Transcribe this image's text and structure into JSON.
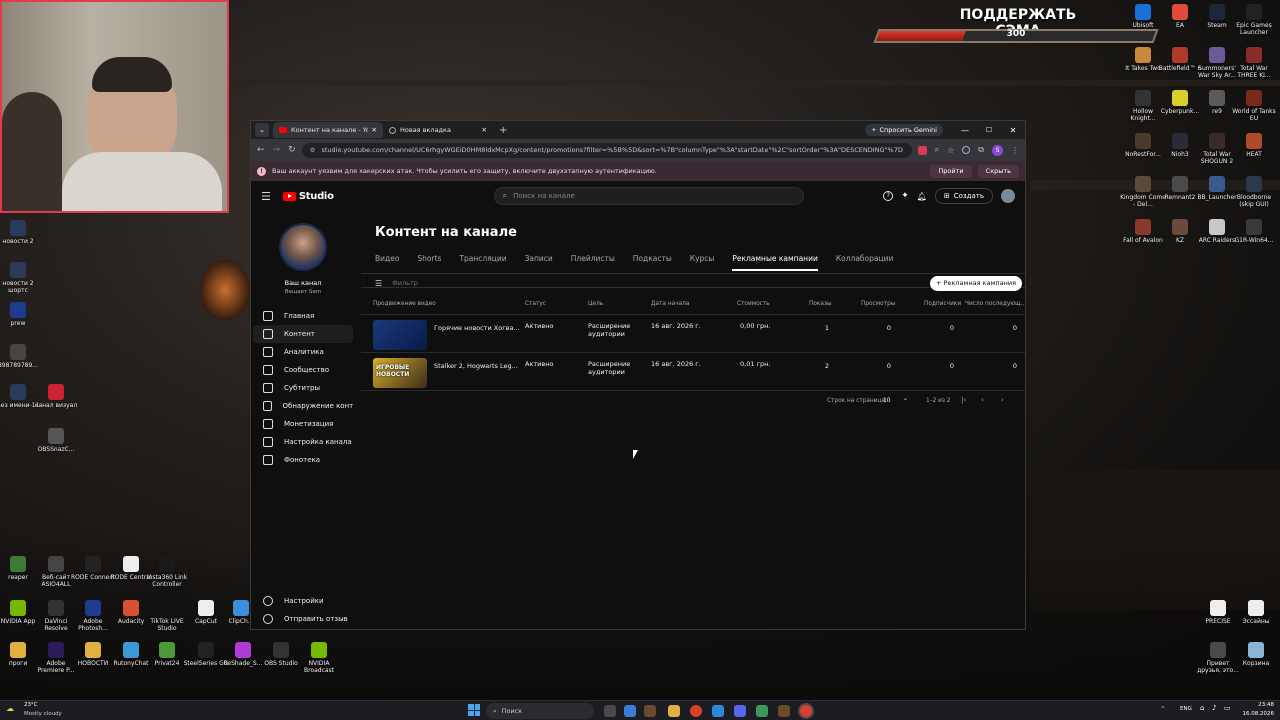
{
  "desktop": {
    "donate": {
      "title": "ПОДДЕРЖАТЬ СЭМА",
      "value": "300"
    },
    "left_icons": [
      {
        "label": "новости 2",
        "color": "#2a3a5a"
      },
      {
        "label": "новости 2 шортс",
        "color": "#2a3a5a"
      },
      {
        "label": "prew",
        "color": "#1e3b8f"
      },
      {
        "label": "898789789...",
        "color": "#444"
      },
      {
        "label": "Без имени-11",
        "color": "#2a3a5a"
      },
      {
        "label": "канал визуал",
        "color": "#c23"
      },
      {
        "label": "OBSSnazC...",
        "color": "#555"
      }
    ],
    "bottom_row1": [
      {
        "label": "reaper",
        "color": "#3a7a3a"
      },
      {
        "label": "Веб-сайт ASIO4ALL",
        "color": "#444"
      },
      {
        "label": "RODE Connect",
        "color": "#222"
      },
      {
        "label": "RODE Central",
        "color": "#eee"
      },
      {
        "label": "Insta360 Link Controller",
        "color": "#1a1a1a"
      }
    ],
    "bottom_row2": [
      {
        "label": "NVIDIA App",
        "color": "#76b900"
      },
      {
        "label": "DaVinci Resolve",
        "color": "#333"
      },
      {
        "label": "Adobe Photosh...",
        "color": "#1e3b8f"
      },
      {
        "label": "Audacity",
        "color": "#d8512c"
      },
      {
        "label": "TikTok LIVE Studio",
        "color": "#111"
      },
      {
        "label": "CapCut",
        "color": "#eee"
      },
      {
        "label": "ClipCh...",
        "color": "#3a8fd8"
      }
    ],
    "bottom_row3": [
      {
        "label": "проги",
        "color": "#e0b040"
      },
      {
        "label": "Adobe Premiere P...",
        "color": "#2a1b5a"
      },
      {
        "label": "НОВОСТИ",
        "color": "#e0b040"
      },
      {
        "label": "RutonyChat",
        "color": "#3a9ad8"
      },
      {
        "label": "Privat24",
        "color": "#4a9a3a"
      },
      {
        "label": "SteelSeries GG",
        "color": "#222"
      },
      {
        "label": "ReShade_S...",
        "color": "#b03ad8"
      },
      {
        "label": "OBS Studio",
        "color": "#333"
      },
      {
        "label": "NVIDIA Broadcast",
        "color": "#76b900"
      }
    ],
    "right_icons": [
      {
        "label": "Ubisoft",
        "color": "#1b6fd8"
      },
      {
        "label": "EA",
        "color": "#e04a3a"
      },
      {
        "label": "Steam",
        "color": "#1b2838"
      },
      {
        "label": "Epic Games Launcher",
        "color": "#222"
      },
      {
        "label": "It Takes Two",
        "color": "#c88a3a"
      },
      {
        "label": "Battlefield™ 6",
        "color": "#b03a2a"
      },
      {
        "label": "Summoners' War Sky Ar...",
        "color": "#6a5a9a"
      },
      {
        "label": "Total War THREE KI...",
        "color": "#8a2a2a"
      },
      {
        "label": "Hollow Knight...",
        "color": "#333"
      },
      {
        "label": "Cyberpunk...",
        "color": "#d8d02a"
      },
      {
        "label": "re9",
        "color": "#5a5a5a"
      },
      {
        "label": "World of Tanks EU",
        "color": "#7a2a1a"
      },
      {
        "label": "NoRestFor...",
        "color": "#4a3a2a"
      },
      {
        "label": "Nioh3",
        "color": "#2a2a3a"
      },
      {
        "label": "Total War SHOGUN 2",
        "color": "#3a2a2a"
      },
      {
        "label": "HEAT",
        "color": "#b04a2a"
      },
      {
        "label": "Kingdom Come - Del...",
        "color": "#5a4a3a"
      },
      {
        "label": "Remnant2",
        "color": "#4a4a4a"
      },
      {
        "label": "BB_Launcher",
        "color": "#3a5a8a"
      },
      {
        "label": "Bloodborne (skip GUI)",
        "color": "#2a3a4a"
      },
      {
        "label": "Fall of Avalon",
        "color": "#8a3a2a"
      },
      {
        "label": "KZ",
        "color": "#6a4a3a"
      },
      {
        "label": "ARC Raiders",
        "color": "#c8c8c8"
      },
      {
        "label": "G1R-Win64...",
        "color": "#3a3a3a"
      }
    ],
    "right_bottom_icons": [
      {
        "label": "PRECISE",
        "color": "#eee"
      },
      {
        "label": "Эссайны",
        "color": "#eee"
      },
      {
        "label": "Привет друзья, это...",
        "color": "#4a4a4a"
      },
      {
        "label": "Корзина",
        "color": "#8ab4d8"
      }
    ]
  },
  "browser": {
    "tabs": [
      {
        "title": "Контент на канале - YouTube S",
        "active": true
      },
      {
        "title": "Новая вкладка",
        "active": false
      }
    ],
    "gemini_label": "Спросить Gemini",
    "profile_letter": "S",
    "url": "studio.youtube.com/channel/UC6rhgyWGEiD0HM8ldxMcpXg/content/promotions?filter=%5B%5D&sort=%7B\"columnType\"%3A\"startDate\"%2C\"sortOrder\"%3A\"DESCENDING\"%7D",
    "warning": {
      "text": "Ваш аккаунт уязвим для хакерских атак. Чтобы усилить его защиту, включите двухэтапную аутентификацию.",
      "primary": "Пройти",
      "secondary": "Скрыть"
    }
  },
  "studio": {
    "logo": "Studio",
    "search_placeholder": "Поиск на канале",
    "create_label": "Создать",
    "channel": {
      "name": "Ваш канал",
      "handle": "Вещает Sam"
    },
    "nav": [
      "Главная",
      "Контент",
      "Аналитика",
      "Сообщество",
      "Субтитры",
      "Обнаружение контен...",
      "Монетизация",
      "Настройка канала",
      "Фонотека"
    ],
    "nav_bottom": [
      "Настройки",
      "Отправить отзыв"
    ],
    "page_title": "Контент на канале",
    "tabs": [
      "Видео",
      "Shorts",
      "Трансляции",
      "Записи",
      "Плейлисты",
      "Подкасты",
      "Курсы",
      "Рекламные кампании",
      "Коллаборации"
    ],
    "active_tab": "Рекламные кампании",
    "filter_placeholder": "Фильтр",
    "new_campaign": "+ Рекламная кампания",
    "columns": [
      "Продвижение видео",
      "Статус",
      "Цель",
      "Дата начала",
      "Стоимость",
      "Показы",
      "Просмотры",
      "Подписчики",
      "Число последующ..."
    ],
    "rows": [
      {
        "title": "Горячие новости Хогва...",
        "status": "Активно",
        "goal": "Расширение аудитории",
        "date": "16 авг. 2026 г.",
        "cost": "0,00 грн.",
        "impressions": "1",
        "views": "0",
        "subs": "0",
        "followups": "0",
        "thumb_text": ""
      },
      {
        "title": "Stalker 2, Hogwarts Leg...",
        "status": "Активно",
        "goal": "Расширение аудитории",
        "date": "16 авг. 2026 г.",
        "cost": "0,01 грн.",
        "impressions": "2",
        "views": "0",
        "subs": "0",
        "followups": "0",
        "thumb_text": "ИГРОВЫЕ НОВОСТИ"
      }
    ],
    "pagination": {
      "rows_label": "Строк на странице:",
      "rows_value": "10",
      "range": "1–2 из 2"
    }
  },
  "taskbar": {
    "weather_temp": "23°C",
    "weather_text": "Mostly cloudy",
    "search_placeholder": "Поиск",
    "lang": "ENG",
    "time": "23:48",
    "date": "16.08.2026"
  }
}
